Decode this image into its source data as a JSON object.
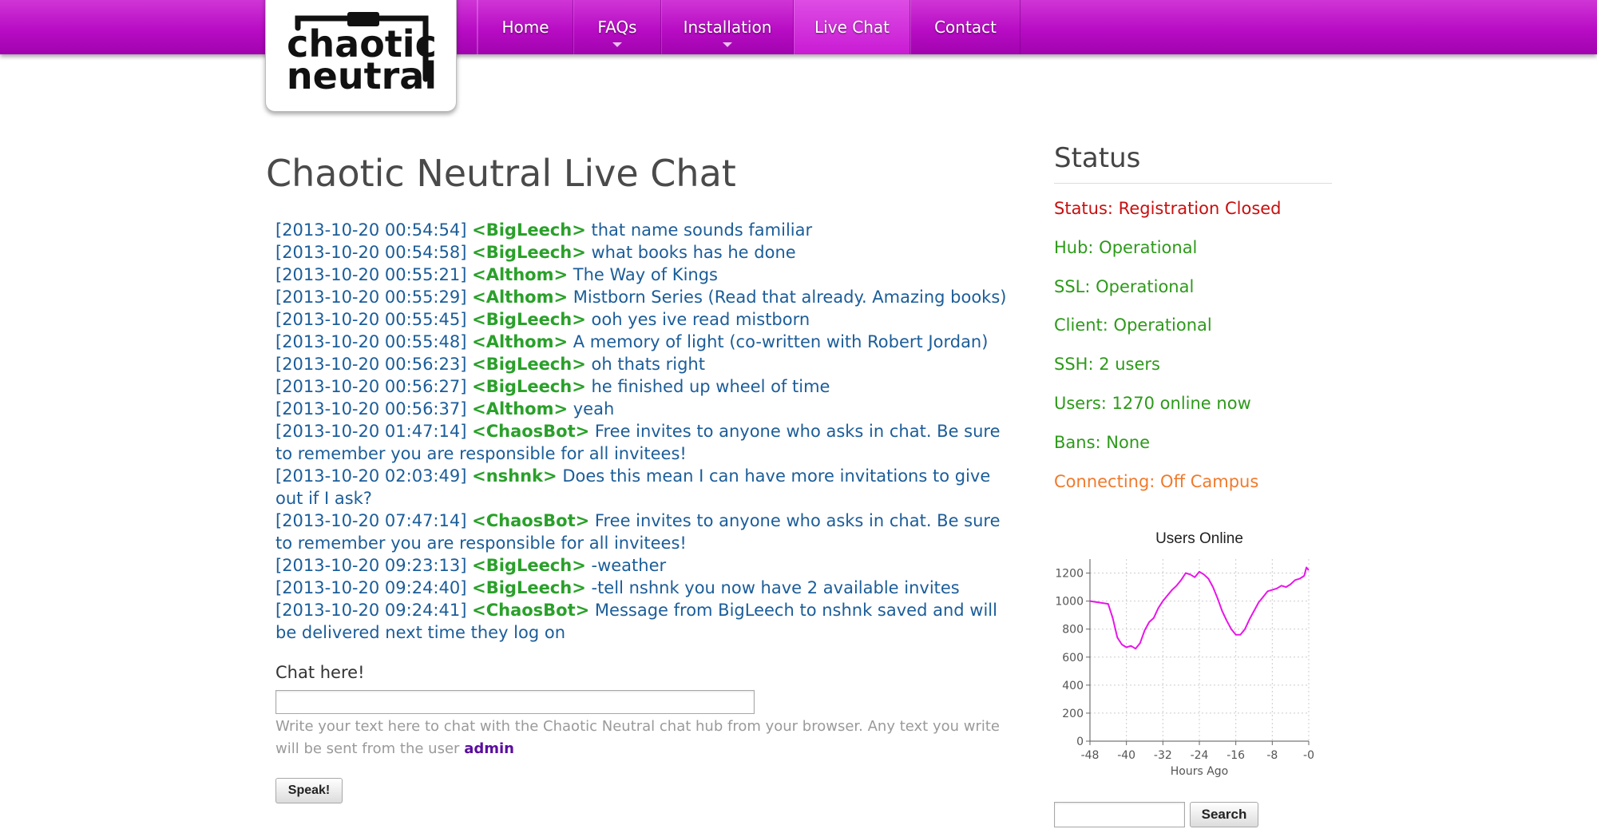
{
  "site": {
    "logo_text": [
      "chaotic",
      "neutral"
    ]
  },
  "nav": {
    "items": [
      {
        "label": "Home",
        "dropdown": false,
        "active": false
      },
      {
        "label": "FAQs",
        "dropdown": true,
        "active": false
      },
      {
        "label": "Installation",
        "dropdown": true,
        "active": false
      },
      {
        "label": "Live Chat",
        "dropdown": false,
        "active": true
      },
      {
        "label": "Contact",
        "dropdown": false,
        "active": false
      }
    ]
  },
  "main": {
    "title": "Chaotic Neutral Live Chat",
    "chat": [
      {
        "ts": "[2013-10-20 00:54:54]",
        "user": "<BigLeech>",
        "msg": "that name sounds familiar"
      },
      {
        "ts": "[2013-10-20 00:54:58]",
        "user": "<BigLeech>",
        "msg": "what books has he done"
      },
      {
        "ts": "[2013-10-20 00:55:21]",
        "user": "<Althom>",
        "msg": "The Way of Kings"
      },
      {
        "ts": "[2013-10-20 00:55:29]",
        "user": "<Althom>",
        "msg": "Mistborn Series (Read that already. Amazing books)"
      },
      {
        "ts": "[2013-10-20 00:55:45]",
        "user": "<BigLeech>",
        "msg": "ooh yes ive read mistborn"
      },
      {
        "ts": "[2013-10-20 00:55:48]",
        "user": "<Althom>",
        "msg": "A memory of light (co-written with Robert Jordan)"
      },
      {
        "ts": "[2013-10-20 00:56:23]",
        "user": "<BigLeech>",
        "msg": "oh thats right"
      },
      {
        "ts": "[2013-10-20 00:56:27]",
        "user": "<BigLeech>",
        "msg": "he finished up wheel of time"
      },
      {
        "ts": "[2013-10-20 00:56:37]",
        "user": "<Althom>",
        "msg": "yeah"
      },
      {
        "ts": "[2013-10-20 01:47:14]",
        "user": "<ChaosBot>",
        "msg": "Free invites to anyone who asks in chat. Be sure to remember you are responsible for all invitees!"
      },
      {
        "ts": "[2013-10-20 02:03:49]",
        "user": "<nshnk>",
        "msg": "Does this mean I can have more invitations to give out if I ask?"
      },
      {
        "ts": "[2013-10-20 07:47:14]",
        "user": "<ChaosBot>",
        "msg": "Free invites to anyone who asks in chat. Be sure to remember you are responsible for all invitees!"
      },
      {
        "ts": "[2013-10-20 09:23:13]",
        "user": "<BigLeech>",
        "msg": "-weather"
      },
      {
        "ts": "[2013-10-20 09:24:40]",
        "user": "<BigLeech>",
        "msg": "-tell nshnk you now have 2 available invites"
      },
      {
        "ts": "[2013-10-20 09:24:41]",
        "user": "<ChaosBot>",
        "msg": "Message from BigLeech to nshnk saved and will be delivered next time they log on"
      }
    ],
    "chat_label": "Chat here!",
    "chat_input_value": "",
    "chat_help": "Write your text here to chat with the Chaotic Neutral chat hub from your browser. Any text you write will be sent from the user",
    "chat_user": "admin",
    "speak_label": "Speak!"
  },
  "sidebar": {
    "title": "Status",
    "items": [
      {
        "text": "Status: Registration Closed",
        "color": "#c80f0f"
      },
      {
        "text": "Hub: Operational",
        "color": "#2d9a1a"
      },
      {
        "text": "SSL: Operational",
        "color": "#2d9a1a"
      },
      {
        "text": "Client: Operational",
        "color": "#2d9a1a"
      },
      {
        "text": "SSH: 2 users",
        "color": "#2d9a1a"
      },
      {
        "text": "Users: 1270 online now",
        "color": "#2d9a1a"
      },
      {
        "text": "Bans: None",
        "color": "#2d9a1a"
      },
      {
        "text": "Connecting: Off Campus",
        "color": "#f07a2c"
      }
    ],
    "search_value": "",
    "search_label": "Search"
  },
  "chart_data": {
    "type": "line",
    "title": "Users Online",
    "xlabel": "Hours Ago",
    "ylabel": "",
    "xlim": [
      -48,
      0
    ],
    "ylim": [
      0,
      1300
    ],
    "xticks": [
      "-48",
      "-40",
      "-32",
      "-24",
      "-16",
      "-8",
      "-0"
    ],
    "yticks": [
      "0",
      "200",
      "400",
      "600",
      "800",
      "1000",
      "1200"
    ],
    "grid": true,
    "series": [
      {
        "color": "#e815e8",
        "x": [
          -48,
          -46,
          -44,
          -43,
          -42,
          -41,
          -40,
          -39,
          -38,
          -37,
          -36,
          -35,
          -34,
          -33,
          -32,
          -31,
          -30,
          -29,
          -28,
          -27,
          -26,
          -25,
          -24,
          -23,
          -22,
          -21,
          -20,
          -19,
          -18,
          -17,
          -16,
          -15,
          -14,
          -13,
          -12,
          -11,
          -10,
          -9,
          -8,
          -7,
          -6,
          -5,
          -4,
          -3,
          -2,
          -1,
          -0.5,
          0
        ],
        "y": [
          1000,
          990,
          980,
          880,
          740,
          690,
          670,
          680,
          660,
          700,
          790,
          850,
          880,
          950,
          1000,
          1040,
          1080,
          1110,
          1150,
          1200,
          1190,
          1170,
          1210,
          1190,
          1160,
          1100,
          1020,
          930,
          860,
          800,
          760,
          760,
          800,
          870,
          930,
          990,
          1030,
          1070,
          1080,
          1090,
          1110,
          1100,
          1120,
          1150,
          1160,
          1180,
          1240,
          1220
        ]
      }
    ]
  }
}
